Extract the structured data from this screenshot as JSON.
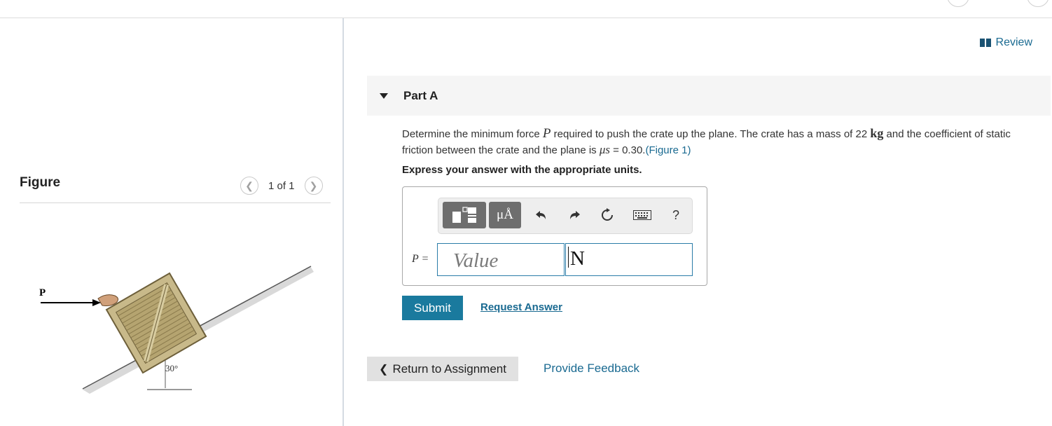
{
  "figure_panel": {
    "title": "Figure",
    "pagination": "1 of 1",
    "image_labels": {
      "force": "P",
      "angle": "30°"
    }
  },
  "header": {
    "review_label": "Review"
  },
  "part": {
    "title": "Part A",
    "question_prefix": "Determine the minimum force ",
    "force_symbol": "P",
    "question_mid": " required to push the crate up the plane. The crate has a mass of 22 ",
    "mass_unit": "kg",
    "question_suffix": " and the coefficient of static friction between the crate and the plane is ",
    "mu_symbol": "μs",
    "mu_value": " = 0.30.",
    "figure_link": "(Figure 1)",
    "instruction": "Express your answer with the appropriate units."
  },
  "toolbar": {
    "units_button": "μÅ",
    "help_label": "?"
  },
  "answer": {
    "variable_label": "P =",
    "value_placeholder": "Value",
    "unit_value": "N"
  },
  "actions": {
    "submit_label": "Submit",
    "request_answer_label": "Request Answer",
    "return_label": "Return to Assignment",
    "feedback_label": "Provide Feedback"
  },
  "colors": {
    "accent": "#1a7a9e",
    "link": "#1a6a91",
    "toolbar_button": "#6e6e6e"
  }
}
